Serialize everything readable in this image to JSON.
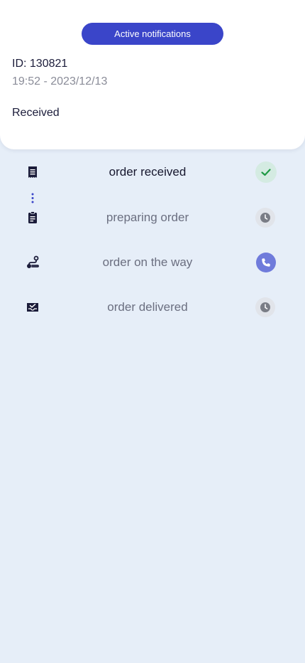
{
  "header": {
    "notifications_button": "Active notifications",
    "order_id": "ID: 130821",
    "datetime": "19:52 - 2023/12/13",
    "status": "Received"
  },
  "steps": [
    {
      "label": "order received",
      "icon": "receipt-icon",
      "state": "done",
      "state_icon": "check-icon"
    },
    {
      "label": "preparing order",
      "icon": "clipboard-icon",
      "state": "pending",
      "state_icon": "clock-icon"
    },
    {
      "label": "order on the way",
      "icon": "delivery-route-icon",
      "state": "call",
      "state_icon": "phone-icon"
    },
    {
      "label": "order delivered",
      "icon": "inbox-check-icon",
      "state": "pending",
      "state_icon": "clock-icon"
    }
  ],
  "colors": {
    "background": "#e6eef8",
    "accent": "#3a45c9",
    "success": "#1f9a45",
    "pending": "#7a7d86",
    "call": "#6f7bdb"
  }
}
